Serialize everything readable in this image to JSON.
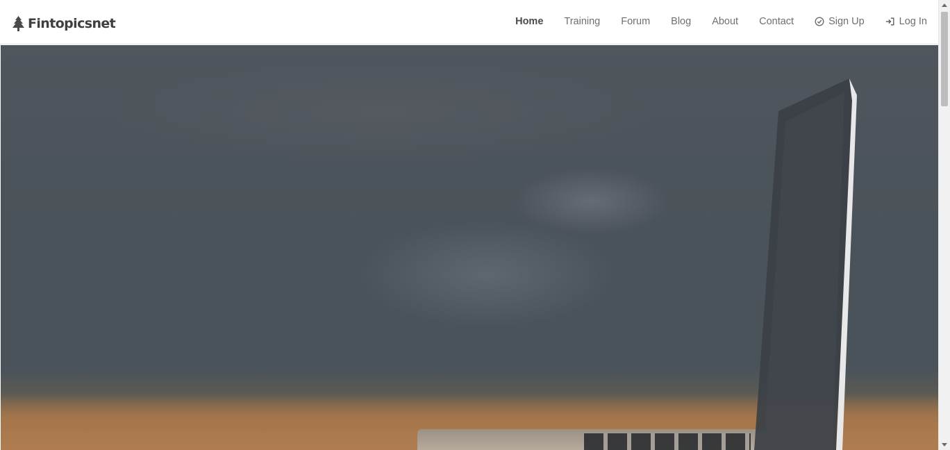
{
  "brand": {
    "name": "Fintopicsnet",
    "icon": "pine-tree-icon",
    "color": "#3f3f3f"
  },
  "nav": {
    "items": [
      {
        "label": "Home",
        "active": true
      },
      {
        "label": "Training",
        "active": false
      },
      {
        "label": "Forum",
        "active": false
      },
      {
        "label": "Blog",
        "active": false
      },
      {
        "label": "About",
        "active": false
      },
      {
        "label": "Contact",
        "active": false
      },
      {
        "label": "Sign Up",
        "icon": "check-circle-icon",
        "active": false
      },
      {
        "label": "Log In",
        "icon": "sign-in-icon",
        "active": false
      }
    ],
    "text_color": "#6f6f6f",
    "active_color": "#4a4a4a"
  },
  "hero": {
    "image": "blurred-chalkboard-with-laptop-photo"
  }
}
